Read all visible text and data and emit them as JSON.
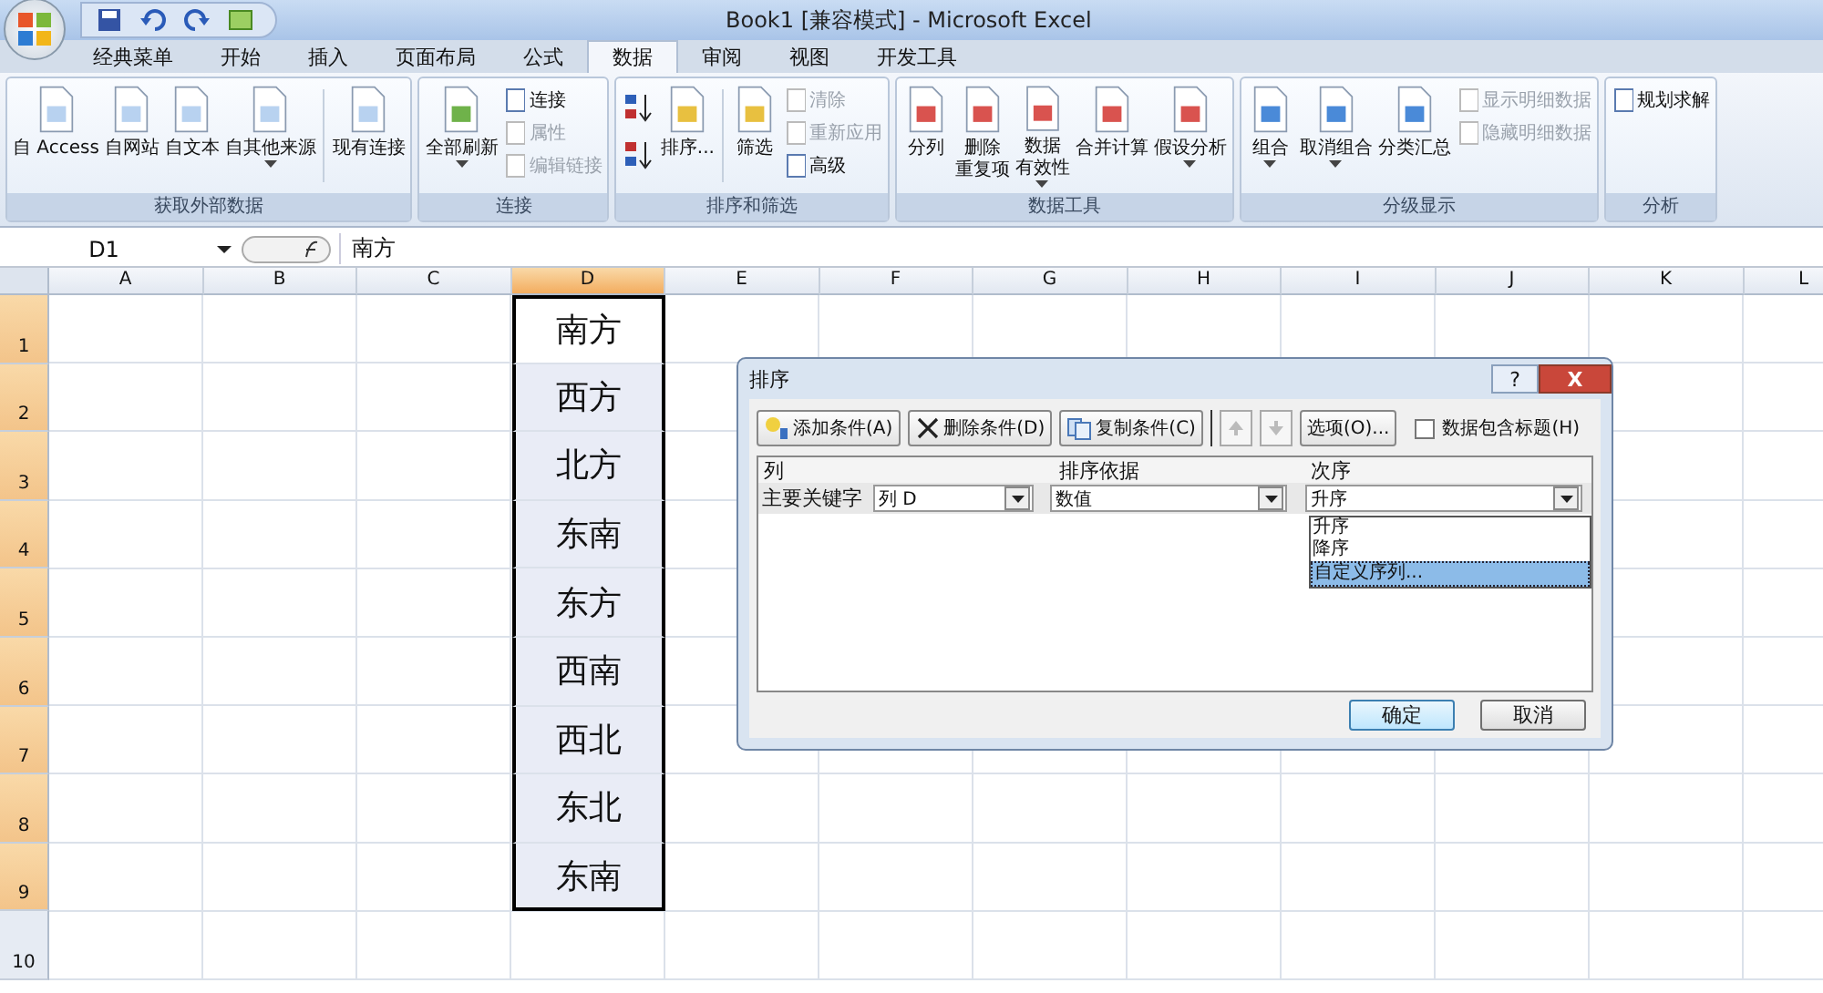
{
  "window": {
    "title": "Book1  [兼容模式] - Microsoft Excel"
  },
  "tabs": [
    {
      "label": "经典菜单",
      "selected": false
    },
    {
      "label": "开始",
      "selected": false
    },
    {
      "label": "插入",
      "selected": false
    },
    {
      "label": "页面布局",
      "selected": false
    },
    {
      "label": "公式",
      "selected": false
    },
    {
      "label": "数据",
      "selected": true
    },
    {
      "label": "审阅",
      "selected": false
    },
    {
      "label": "视图",
      "selected": false
    },
    {
      "label": "开发工具",
      "selected": false
    }
  ],
  "ribbon": [
    {
      "title": "获取外部数据",
      "stacks": [
        {
          "kind": "large",
          "label": "自 Access",
          "dropdown": false
        },
        {
          "kind": "large",
          "label": "自网站",
          "dropdown": false
        },
        {
          "kind": "large",
          "label": "自文本",
          "dropdown": false
        },
        {
          "kind": "large",
          "label": "自其他来源",
          "dropdown": true
        },
        {
          "kind": "separator"
        },
        {
          "kind": "large",
          "label": "现有连接",
          "dropdown": false
        }
      ]
    },
    {
      "title": "连接",
      "stacks": [
        {
          "kind": "large",
          "label": "全部刷新",
          "dropdown": true
        },
        {
          "kind": "stack",
          "items": [
            {
              "kind": "small",
              "label": "连接",
              "disabled": false
            },
            {
              "kind": "small",
              "label": "属性",
              "disabled": true
            },
            {
              "kind": "small",
              "label": "编辑链接",
              "disabled": true
            }
          ]
        }
      ]
    },
    {
      "title": "排序和筛选",
      "stacks": [
        {
          "kind": "stack",
          "items": [
            {
              "kind": "sort_az"
            },
            {
              "kind": "sort_za"
            }
          ]
        },
        {
          "kind": "large",
          "label": "排序...",
          "dropdown": false
        },
        {
          "kind": "separator"
        },
        {
          "kind": "large",
          "label": "筛选",
          "dropdown": false
        },
        {
          "kind": "stack",
          "items": [
            {
              "kind": "small",
              "label": "清除",
              "disabled": true
            },
            {
              "kind": "small",
              "label": "重新应用",
              "disabled": true
            },
            {
              "kind": "small",
              "label": "高级",
              "disabled": false
            }
          ]
        }
      ]
    },
    {
      "title": "数据工具",
      "stacks": [
        {
          "kind": "large",
          "label": "分列",
          "dropdown": false
        },
        {
          "kind": "large",
          "label": "删除",
          "label_2": "重复项",
          "dropdown": false
        },
        {
          "kind": "large",
          "label": "数据",
          "label_2": "有效性",
          "dropdown": true
        },
        {
          "kind": "large",
          "label": "合并计算",
          "dropdown": false
        },
        {
          "kind": "large",
          "label": "假设分析",
          "dropdown": true
        }
      ]
    },
    {
      "title": "分级显示",
      "stacks": [
        {
          "kind": "large",
          "label": "组合",
          "dropdown": true
        },
        {
          "kind": "large",
          "label": "取消组合",
          "dropdown": true
        },
        {
          "kind": "large",
          "label": "分类汇总",
          "dropdown": false
        },
        {
          "kind": "stack",
          "items": [
            {
              "kind": "small",
              "label": "显示明细数据",
              "disabled": true
            },
            {
              "kind": "small",
              "label": "隐藏明细数据",
              "disabled": true
            }
          ]
        }
      ]
    },
    {
      "title": "分析",
      "stacks": [
        {
          "kind": "stack",
          "items": [
            {
              "kind": "small",
              "label": "规划求解",
              "disabled": false
            }
          ]
        }
      ]
    }
  ],
  "formula_bar": {
    "name_box": "D1",
    "value": "南方"
  },
  "sheet": {
    "columns": [
      {
        "label": "A",
        "selected": false
      },
      {
        "label": "B",
        "selected": false
      },
      {
        "label": "C",
        "selected": false
      },
      {
        "label": "D",
        "selected": true
      },
      {
        "label": "E",
        "selected": false
      },
      {
        "label": "F",
        "selected": false
      },
      {
        "label": "G",
        "selected": false
      },
      {
        "label": "H",
        "selected": false
      },
      {
        "label": "I",
        "selected": false
      },
      {
        "label": "J",
        "selected": false
      },
      {
        "label": "K",
        "selected": false
      },
      {
        "label": "L",
        "selected": false
      }
    ],
    "rows": [
      {
        "header": "1",
        "selected": true,
        "cells": [
          null,
          null,
          null,
          {
            "text": "南方",
            "selected": true,
            "active": true
          }
        ]
      },
      {
        "header": "2",
        "selected": true,
        "cells": [
          null,
          null,
          null,
          {
            "text": "西方",
            "selected": true,
            "active": false
          }
        ]
      },
      {
        "header": "3",
        "selected": true,
        "cells": [
          null,
          null,
          null,
          {
            "text": "北方",
            "selected": true,
            "active": false
          }
        ]
      },
      {
        "header": "4",
        "selected": true,
        "cells": [
          null,
          null,
          null,
          {
            "text": "东南",
            "selected": true,
            "active": false
          }
        ]
      },
      {
        "header": "5",
        "selected": true,
        "cells": [
          null,
          null,
          null,
          {
            "text": "东方",
            "selected": true,
            "active": false
          }
        ]
      },
      {
        "header": "6",
        "selected": true,
        "cells": [
          null,
          null,
          null,
          {
            "text": "西南",
            "selected": true,
            "active": false
          }
        ]
      },
      {
        "header": "7",
        "selected": true,
        "cells": [
          null,
          null,
          null,
          {
            "text": "西北",
            "selected": true,
            "active": false
          }
        ]
      },
      {
        "header": "8",
        "selected": true,
        "cells": [
          null,
          null,
          null,
          {
            "text": "东北",
            "selected": true,
            "active": false
          }
        ]
      },
      {
        "header": "9",
        "selected": true,
        "cells": [
          null,
          null,
          null,
          {
            "text": "东南",
            "selected": true,
            "active": false
          }
        ]
      },
      {
        "header": "10",
        "selected": false,
        "cells": []
      }
    ]
  },
  "dialog": {
    "title": "排序",
    "help": "?",
    "close": "X",
    "toolbar": [
      {
        "label": "添加条件(A)",
        "kind": "add"
      },
      {
        "label": "删除条件(D)",
        "kind": "delete"
      },
      {
        "label": "复制条件(C)",
        "kind": "copy"
      }
    ],
    "move_up": {
      "disabled": true
    },
    "move_down": {
      "disabled": true
    },
    "options": "选项(O)...",
    "header_checkbox": {
      "label": "数据包含标题(H)",
      "checked": false
    },
    "headers": [
      "列",
      "排序依据",
      "次序"
    ],
    "row": {
      "label": "主要关键字",
      "column": "列 D",
      "sort_on": "数值",
      "order": "升序"
    },
    "order_options": [
      {
        "label": "升序",
        "selected": false
      },
      {
        "label": "降序",
        "selected": false
      },
      {
        "label": "自定义序列...",
        "selected": true
      }
    ],
    "ok": "确定",
    "cancel": "取消"
  }
}
